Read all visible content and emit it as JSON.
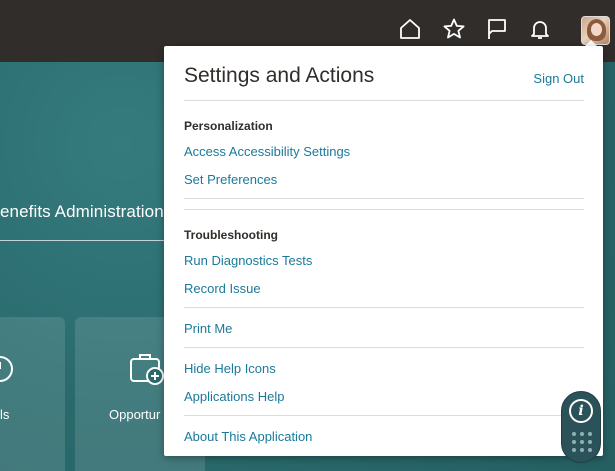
{
  "header": {
    "icons": [
      "home-icon",
      "star-icon",
      "flag-icon",
      "bell-icon"
    ],
    "avatar": "user-avatar"
  },
  "background": {
    "title": "enefits Administration",
    "tiles": [
      {
        "label": "ls",
        "icon": "timer-icon"
      },
      {
        "label": "Opportur",
        "icon": "briefcase-icon"
      }
    ]
  },
  "panel": {
    "title": "Settings and Actions",
    "sign_out": "Sign Out",
    "personalization": {
      "heading": "Personalization",
      "items": [
        "Access Accessibility Settings",
        "Set Preferences"
      ]
    },
    "troubleshooting": {
      "heading": "Troubleshooting",
      "items": [
        "Run Diagnostics Tests",
        "Record Issue"
      ]
    },
    "print": "Print Me",
    "help": {
      "items": [
        "Hide Help Icons",
        "Applications Help"
      ]
    },
    "about": "About This Application"
  },
  "colors": {
    "header_bg": "#312d2a",
    "link": "#1b7a9a",
    "background": "#2b6d70"
  }
}
